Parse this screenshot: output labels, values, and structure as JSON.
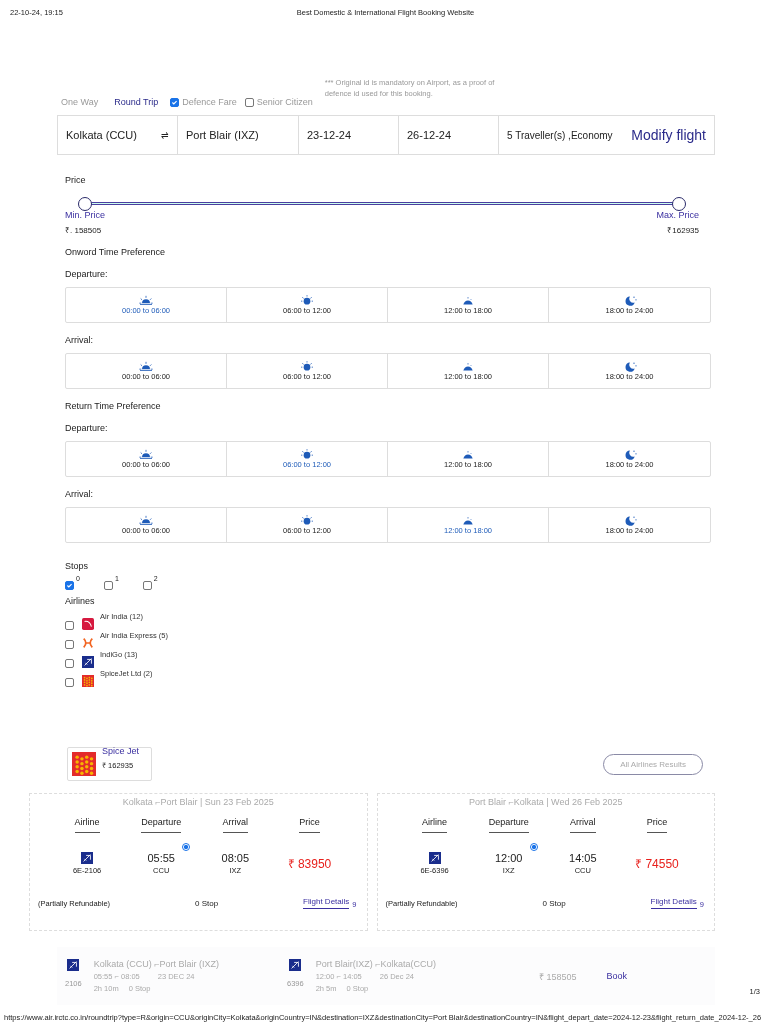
{
  "print_header": {
    "datetime": "22-10-24, 19:15",
    "title": "Best Domestic & International Flight Booking Website"
  },
  "trip_options": {
    "types": [
      {
        "label": "One Way",
        "selected": false
      },
      {
        "label": "Round Trip",
        "selected": true
      }
    ],
    "fares": [
      {
        "label": "Defence Fare",
        "checked": true
      },
      {
        "label": "Senior Citizen",
        "checked": false
      }
    ],
    "note": "*** Original id is mandatory on Airport, as a proof of defence id used for this booking."
  },
  "search": {
    "from": "Kolkata (CCU)",
    "swap": "⇌",
    "to": "Port Blair (IXZ)",
    "depart": "23-12-24",
    "return": "26-12-24",
    "travellers": "5 Traveller(s) ,Economy",
    "modify": "Modify flight"
  },
  "price_filter": {
    "title": "Price",
    "thumbs": [
      {
        "label": "Min. Price",
        "value": "₹. 158505",
        "level": 0
      },
      {
        "label": "Max. Price",
        "value": "₹162935",
        "level": 1
      }
    ]
  },
  "time_preferences": [
    {
      "title": "Onword Time Preference",
      "groups": [
        {
          "label": "Departure:",
          "slots": [
            {
              "kind": "sunrise",
              "label": "00:00 to 06:00",
              "selected": true
            },
            {
              "kind": "sun",
              "label": "06:00 to 12:00",
              "selected": false
            },
            {
              "kind": "sunset",
              "label": "12:00 to 18:00",
              "selected": false
            },
            {
              "kind": "night",
              "label": "18:00 to 24:00",
              "selected": false
            }
          ]
        },
        {
          "label": "Arrival:",
          "slots": [
            {
              "kind": "sunrise",
              "label": "00:00 to 06:00",
              "selected": false
            },
            {
              "kind": "sun",
              "label": "06:00 to 12:00",
              "selected": false
            },
            {
              "kind": "sunset",
              "label": "12:00 to 18:00",
              "selected": false
            },
            {
              "kind": "night",
              "label": "18:00 to 24:00",
              "selected": false
            }
          ]
        }
      ]
    },
    {
      "title": "Return Time Preference",
      "groups": [
        {
          "label": "Departure:",
          "slots": [
            {
              "kind": "sunrise",
              "label": "00:00 to 06:00",
              "selected": false
            },
            {
              "kind": "sun",
              "label": "06:00 to 12:00",
              "selected": true
            },
            {
              "kind": "sunset",
              "label": "12:00 to 18:00",
              "selected": false
            },
            {
              "kind": "night",
              "label": "18:00 to 24:00",
              "selected": false
            }
          ]
        },
        {
          "label": "Arrival:",
          "slots": [
            {
              "kind": "sunrise",
              "label": "00:00 to 06:00",
              "selected": false
            },
            {
              "kind": "sun",
              "label": "06:00 to 12:00",
              "selected": false
            },
            {
              "kind": "sunset",
              "label": "12:00 to 18:00",
              "selected": true
            },
            {
              "kind": "night",
              "label": "18:00 to 24:00",
              "selected": false
            }
          ]
        }
      ]
    }
  ],
  "stops": {
    "title": "Stops",
    "options": [
      {
        "label": "0",
        "checked": true
      },
      {
        "label": "1",
        "checked": false
      },
      {
        "label": "2",
        "checked": false
      }
    ]
  },
  "airlines": {
    "title": "Airlines",
    "items": [
      {
        "kind": "airindia",
        "label": "Air India (12)",
        "checked": false
      },
      {
        "kind": "express",
        "label": "Air India Express (5)",
        "checked": false
      },
      {
        "kind": "indigo",
        "label": "IndiGo (13)",
        "checked": false
      },
      {
        "kind": "spicejet",
        "label": "SpiceJet Ltd (2)",
        "checked": false
      }
    ]
  },
  "featured": {
    "kind": "spicejet",
    "name": "Spice Jet",
    "price": "₹ 162935"
  },
  "all_results_button": "All Airlines Results",
  "flight_cards": [
    {
      "heading": "Kolkata ⌐Port Blair | Sun 23 Feb 2025",
      "columns": [
        "Airline",
        "Departure",
        "Arrival",
        "Price"
      ],
      "flight_no": "6E-2106",
      "dep_time": "05:55",
      "dep_code": "CCU",
      "arr_time": "08:05",
      "arr_code": "IXZ",
      "selected": true,
      "price": "₹ 83950",
      "refund": "(Partially Refundable)",
      "stops": "0 Stop",
      "details": "Flight Details",
      "details_mark": "9"
    },
    {
      "heading": "Port Blair ⌐Kolkata | Wed 26 Feb 2025",
      "columns": [
        "Airline",
        "Departure",
        "Arrival",
        "Price"
      ],
      "flight_no": "6E-6396",
      "dep_time": "12:00",
      "dep_code": "IXZ",
      "arr_time": "14:05",
      "arr_code": "CCU",
      "selected": true,
      "price": "₹ 74550",
      "refund": "(Partially Refundable)",
      "stops": "0 Stop",
      "details": "Flight Details",
      "details_mark": "9"
    }
  ],
  "summary": {
    "legs": [
      {
        "number": "2106",
        "route": "Kolkata (CCU) ⌐Port Blair (IXZ)",
        "times": "05:55 ⌐ 08:05",
        "date": "23 DEC 24",
        "duration": "2h 10m",
        "stops": "0 Stop"
      },
      {
        "number": "6396",
        "route": "Port Blair(IXZ) ⌐Kolkata(CCU)",
        "times": "12:00 ⌐ 14:05",
        "date": "26 Dec 24",
        "duration": "2h 5m",
        "stops": "0 Stop"
      }
    ],
    "total": "₹ 158505",
    "book": "Book"
  },
  "print_footer": {
    "url": "https://www.air.irctc.co.in/roundtrip?type=R&origin=CCU&originCity=Kolkata&originCountry=IN&destination=IXZ&destinationCity=Port Blair&destinationCountry=IN&flight_depart_date=2024-12-23&flight_return_date_2024-12-_26",
    "page": "1/3"
  }
}
